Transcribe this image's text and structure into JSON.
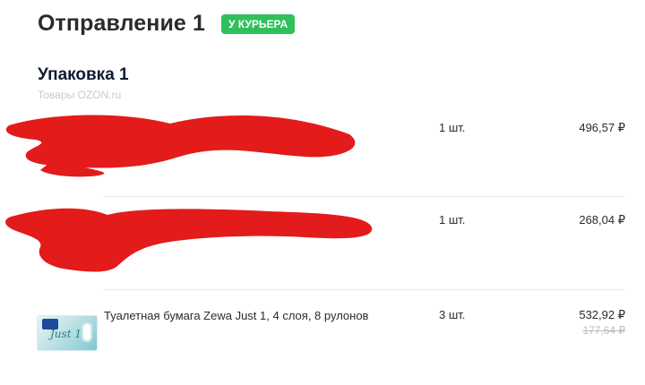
{
  "shipment": {
    "title": "Отправление 1",
    "badge": "У КУРЬЕРА"
  },
  "package": {
    "title": "Упаковка 1",
    "subtitle": "Товары OZON.ru"
  },
  "items": [
    {
      "quantity": "1 шт.",
      "price": "496,57 ₽"
    },
    {
      "quantity": "1 шт.",
      "price": "268,04 ₽"
    },
    {
      "name": "Туалетная бумага Zewa Just 1, 4 слоя, 8 рулонов",
      "quantity": "3 шт.",
      "price": "532,92 ₽",
      "old_price": "177,64 ₽",
      "thumb_text": "Just 1"
    }
  ],
  "colors": {
    "badge_green": "#2fbf5b",
    "redaction_red": "#e31b1b"
  }
}
